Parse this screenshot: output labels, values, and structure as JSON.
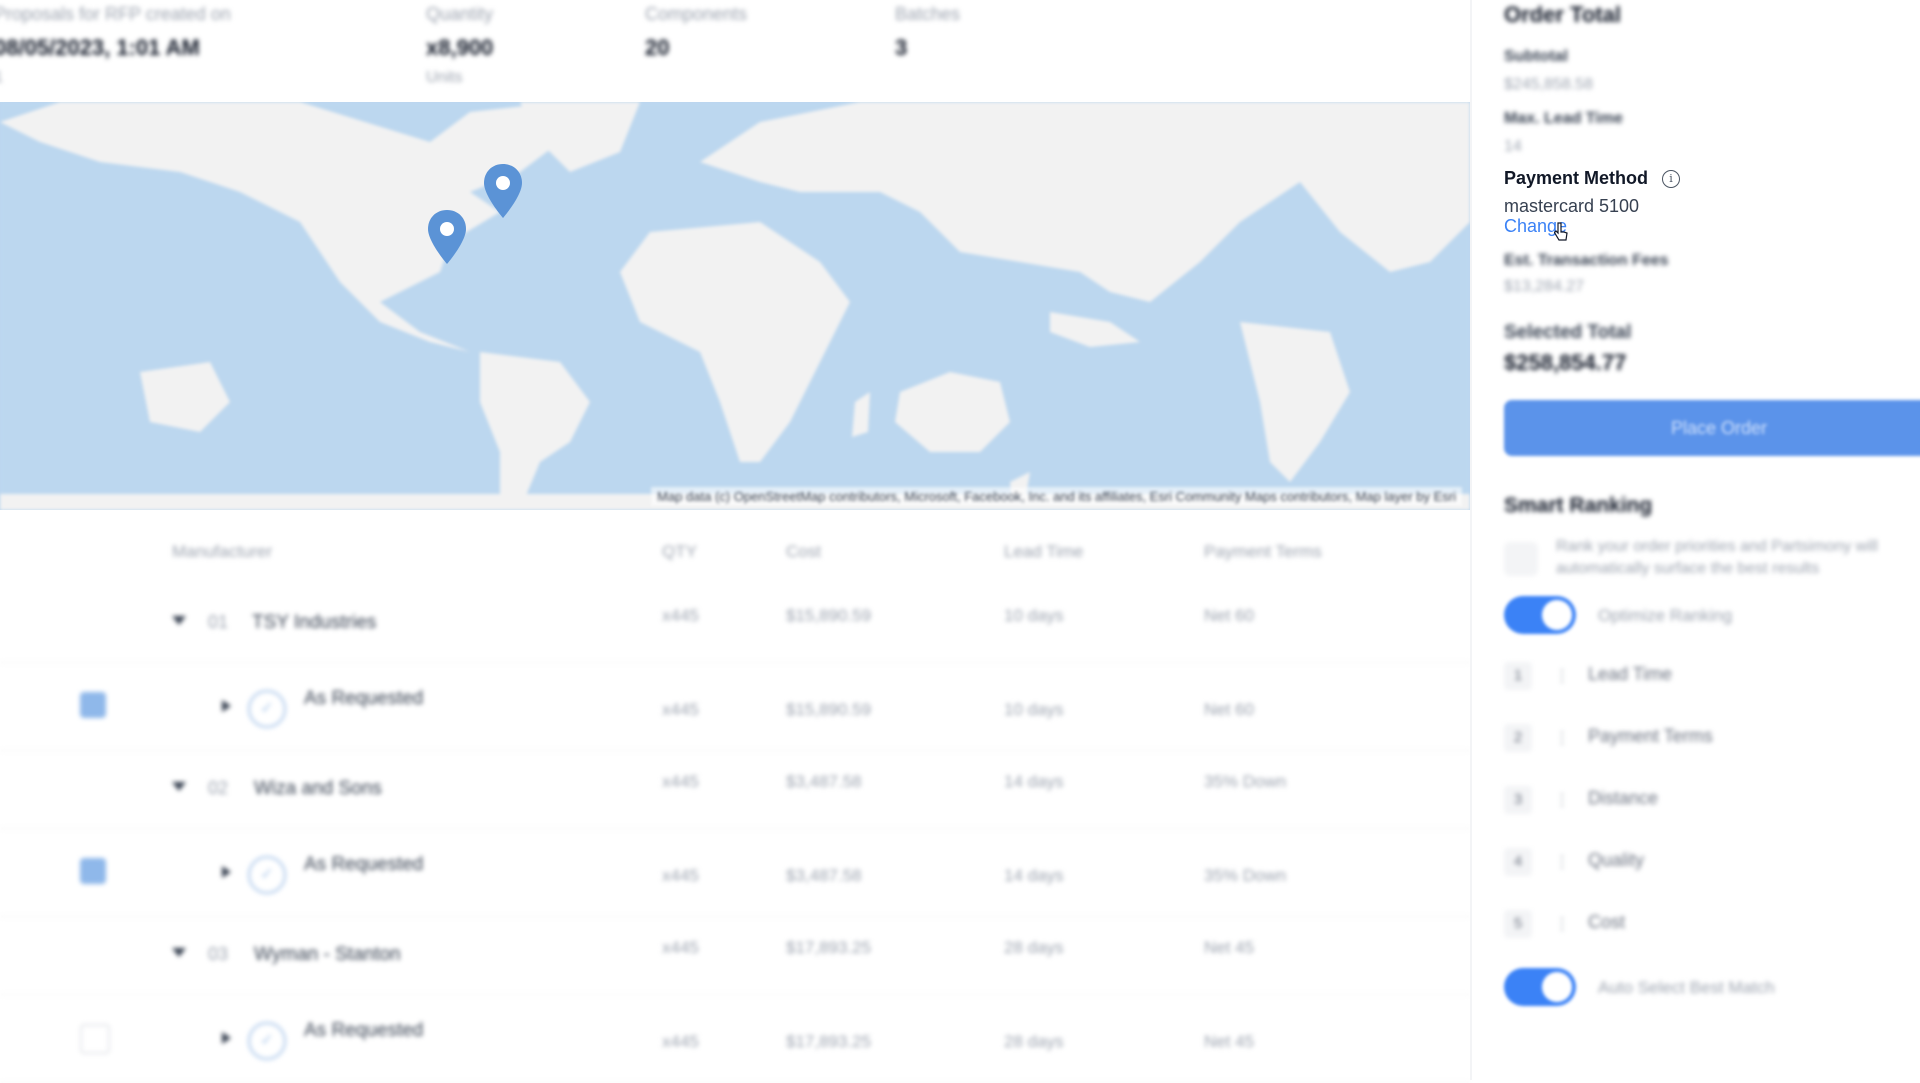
{
  "stats": [
    {
      "label": "Proposals for RFP created on",
      "value": "08/05/2023, 1:01 AM",
      "sub": "1"
    },
    {
      "label": "Quantity",
      "value": "x8,900",
      "sub": "Units"
    },
    {
      "label": "Components",
      "value": "20",
      "sub": ""
    },
    {
      "label": "Batches",
      "value": "3",
      "sub": ""
    }
  ],
  "map": {
    "attribution": "Map data (c) OpenStreetMap contributors, Microsoft, Facebook, Inc. and its affiliates, Esri Community Maps contributors, Map layer by Esri",
    "pin_color": "#5b93d6",
    "land_color": "#f2f2f2",
    "water_color": "#bcd7ef"
  },
  "table": {
    "headers": {
      "manufacturer": "Manufacturer",
      "qty": "QTY",
      "cost": "Cost",
      "lead_time": "Lead Time",
      "payment_terms": "Payment Terms"
    },
    "rows": [
      {
        "type": "group",
        "index": "01",
        "name": "TSY Industries",
        "qty": "x445",
        "cost": "$15,890.59",
        "lead": "10 days",
        "terms": "Net 60"
      },
      {
        "type": "option",
        "checked": true,
        "name": "As Requested",
        "qty": "x445",
        "cost": "$15,890.59",
        "lead": "10 days",
        "terms": "Net 60"
      },
      {
        "type": "group",
        "index": "02",
        "name": "Wiza and Sons",
        "qty": "x445",
        "cost": "$3,487.58",
        "lead": "14 days",
        "terms": "35% Down"
      },
      {
        "type": "option",
        "checked": true,
        "name": "As Requested",
        "qty": "x445",
        "cost": "$3,487.58",
        "lead": "14 days",
        "terms": "35% Down"
      },
      {
        "type": "group",
        "index": "03",
        "name": "Wyman - Stanton",
        "qty": "x445",
        "cost": "$17,893.25",
        "lead": "28 days",
        "terms": "Net 45"
      },
      {
        "type": "option",
        "checked": false,
        "name": "As Requested",
        "qty": "x445",
        "cost": "$17,893.25",
        "lead": "28 days",
        "terms": "Net 45"
      }
    ]
  },
  "panel": {
    "title": "Order Total",
    "subtotal_label": "Subtotal",
    "subtotal_value": "$245,858.58",
    "lead_label": "Max. Lead Time",
    "lead_value": "14",
    "payment_label": "Payment Method",
    "payment_value": "mastercard 5100",
    "payment_change": "Change",
    "fees_label": "Est. Transaction Fees",
    "fees_value": "$13,284.27",
    "selected_label": "Selected Total",
    "selected_value": "$258,854.77",
    "place_order": "Place Order",
    "smart_title": "Smart Ranking",
    "smart_desc": "Rank your order priorities and Partsimony will automatically surface the best results",
    "optimize_label": "Optimize Ranking",
    "ranking": [
      {
        "num": "1",
        "label": "Lead Time"
      },
      {
        "num": "2",
        "label": "Payment Terms"
      },
      {
        "num": "3",
        "label": "Distance"
      },
      {
        "num": "4",
        "label": "Quality"
      },
      {
        "num": "5",
        "label": "Cost"
      }
    ],
    "auto_label": "Auto Select Best Match",
    "accent": "#3b82f6"
  }
}
